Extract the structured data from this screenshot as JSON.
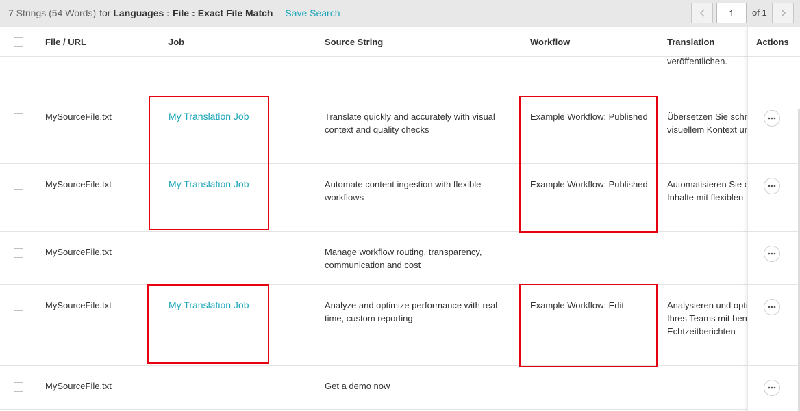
{
  "summary": {
    "count": "7 Strings (54 Words)",
    "for_label": "for",
    "filter_languages": "Languages",
    "sep": ":",
    "filter_file": "File",
    "filter_match": "Exact File Match",
    "save_search": "Save Search"
  },
  "pager": {
    "page": "1",
    "of": "of 1",
    "prev_icon": "chevron-left-icon",
    "next_icon": "chevron-right-icon"
  },
  "columns": {
    "file": "File / URL",
    "job": "Job",
    "source": "Source String",
    "workflow": "Workflow",
    "translation": "Translation",
    "actions": "Actions"
  },
  "partial_row": {
    "translation": "veröffentlichen."
  },
  "rows": [
    {
      "file": "MySourceFile.txt",
      "job": "My Translation Job",
      "source_line1": "Translate quickly and accurately with visual",
      "source_line2": "context and quality checks",
      "workflow": "Example Workflow: Published",
      "translation_line1": "Übersetzen Sie schnell",
      "translation_line2": "visuellem Kontext und",
      "translation_line3": ""
    },
    {
      "file": "MySourceFile.txt",
      "job": "My Translation Job",
      "source_line1": "Automate content ingestion with flexible",
      "source_line2": "workflows",
      "workflow": "Example Workflow: Published",
      "translation_line1": "Automatisieren Sie die",
      "translation_line2": "Inhalte mit flexiblen",
      "translation_line3": ""
    },
    {
      "file": "MySourceFile.txt",
      "job": "",
      "source_line1": "Manage workflow routing, transparency,",
      "source_line2": "communication and cost",
      "workflow": "",
      "translation_line1": "",
      "translation_line2": "",
      "translation_line3": ""
    },
    {
      "file": "MySourceFile.txt",
      "job": "My Translation Job",
      "source_line1": "Analyze and optimize performance with real",
      "source_line2": "time, custom reporting",
      "workflow": "Example Workflow: Edit",
      "translation_line1": "Analysieren und optimieren",
      "translation_line2": "Ihres Teams mit benutzerdefinierten",
      "translation_line3": "Echtzeitberichten"
    },
    {
      "file": "MySourceFile.txt",
      "job": "",
      "source_line1": "Get a demo now",
      "source_line2": "",
      "workflow": "",
      "translation_line1": "",
      "translation_line2": "",
      "translation_line3": ""
    }
  ],
  "icons": {
    "checkbox": "checkbox-icon",
    "more": "more-horizontal-icon"
  },
  "colors": {
    "link": "#1aa5b8",
    "highlight": "#e60012",
    "toolbar": "#e8e8e8"
  }
}
